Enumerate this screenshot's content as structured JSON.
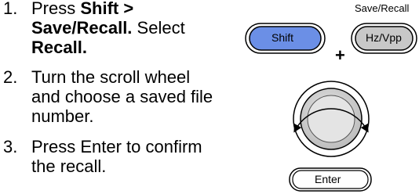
{
  "instructions": {
    "steps": [
      {
        "number": "1.",
        "line1_prefix": "Press ",
        "line1_bold": "Shift >",
        "line2_bold": "Save/Recall.",
        "line2_rest": " Select",
        "line3_bold": "Recall."
      },
      {
        "number": "2.",
        "line1": "Turn the scroll wheel",
        "line2": "and choose a saved file",
        "line3": "number."
      },
      {
        "number": "3.",
        "line1": "Press Enter to confirm",
        "line2": "the recall."
      }
    ]
  },
  "panel": {
    "save_recall_caption": "Save/Recall",
    "shift_key_label": "Shift",
    "plus_sign": "+",
    "hz_vpp_key_label": "Hz/Vpp",
    "enter_key_label": "Enter",
    "colors": {
      "shift_key": "#6b8fe6",
      "key_gray": "#c8c8c8",
      "outline": "#000000"
    },
    "icons": [
      "scroll-wheel-icon",
      "rotate-left-arrow-icon",
      "rotate-right-arrow-icon"
    ]
  }
}
